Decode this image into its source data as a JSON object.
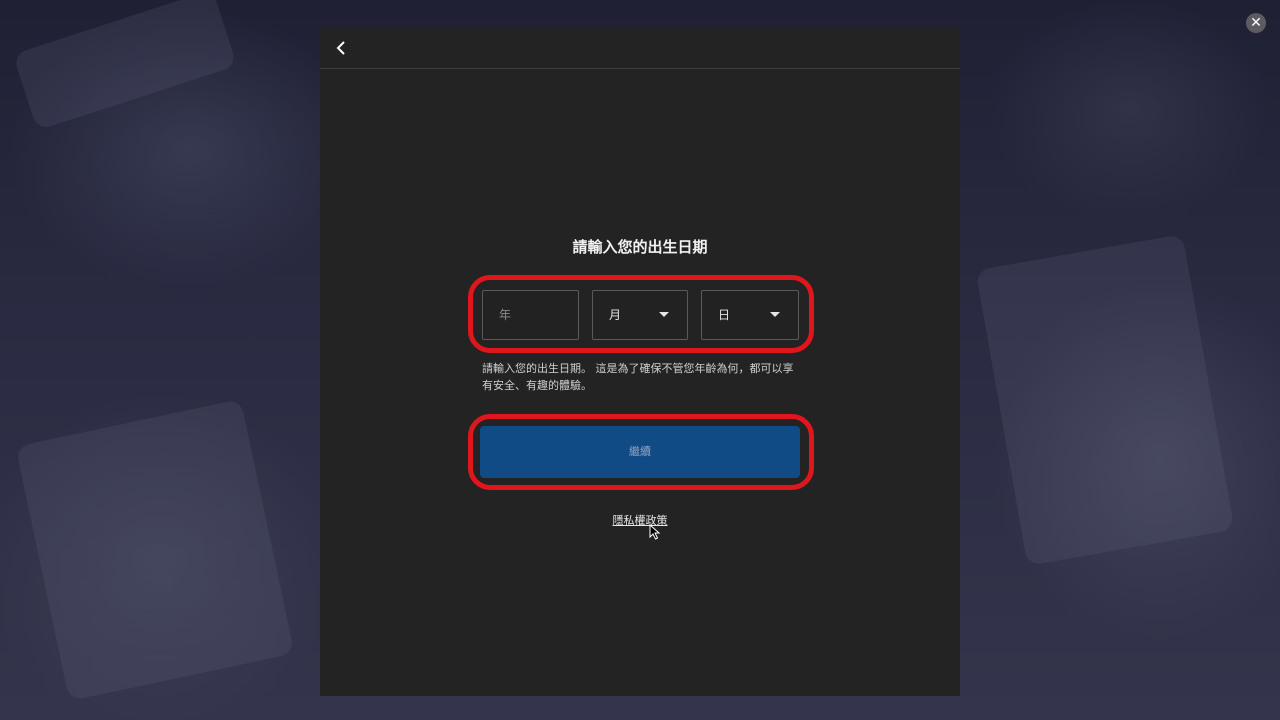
{
  "modal": {
    "title": "請輸入您的出生日期",
    "year_placeholder": "年",
    "month_label": "月",
    "day_label": "日",
    "description": "請輸入您的出生日期。 這是為了確保不管您年齡為何，都可以享有安全、有趣的體驗。",
    "continue_label": "繼續",
    "privacy_label": "隱私權政策"
  },
  "icons": {
    "back": "chevron-left-icon",
    "close": "close-icon",
    "dropdown": "caret-down-icon"
  },
  "colors": {
    "highlight": "#e0161d",
    "button": "#114b86",
    "modal_bg": "#232323"
  }
}
